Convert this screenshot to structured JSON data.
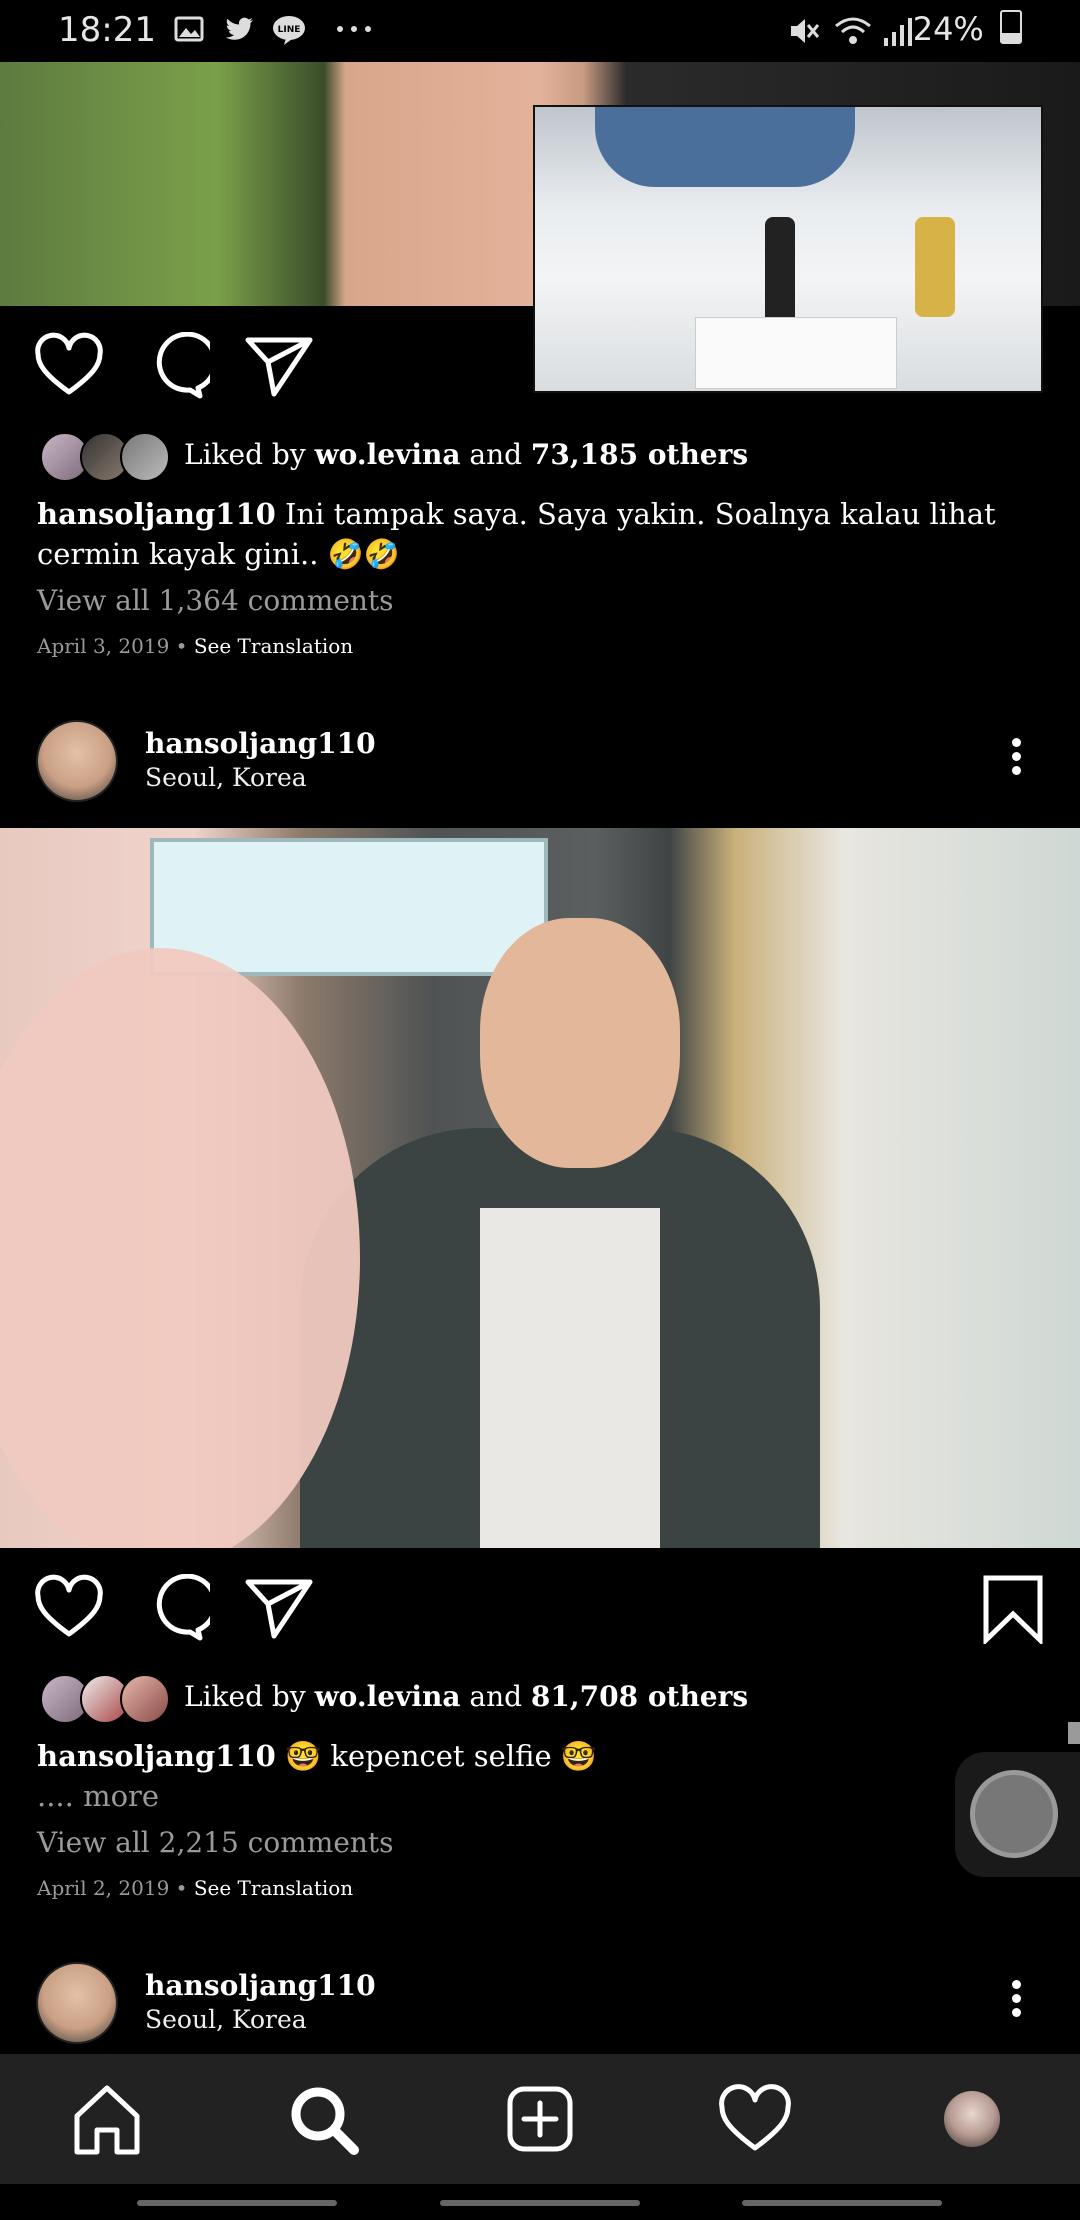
{
  "status_bar": {
    "time": "18:21",
    "icons": [
      "image-icon",
      "twitter-icon",
      "line-icon",
      "more-dots-icon"
    ],
    "right_icons": [
      "mute-icon",
      "wifi-icon",
      "signal-icon"
    ],
    "battery": "24%"
  },
  "post1": {
    "liked_prefix": "Liked by ",
    "liked_user": "wo.levina",
    "liked_and": " and ",
    "liked_others": "73,185 others",
    "caption_user": "hansoljang110",
    "caption_text": " Ini tampak saya. Saya yakin. Soalnya kalau lihat cermin kayak gini.. 🤣🤣",
    "view_comments": "View all 1,364 comments",
    "date": "April 3, 2019 • ",
    "see_translation": "See Translation"
  },
  "post2": {
    "username": "hansoljang110",
    "location": "Seoul, Korea",
    "liked_prefix": "Liked by ",
    "liked_user": "wo.levina",
    "liked_and": " and ",
    "liked_others": "81,708 others",
    "caption_user": "hansoljang110",
    "caption_text": " 🤓 kepencet selfie 🤓",
    "more_prefix": "....",
    "more": " more",
    "view_comments": "View all 2,215 comments",
    "date": "April 2, 2019 • ",
    "see_translation": "See Translation"
  },
  "post3": {
    "username": "hansoljang110",
    "location": "Seoul, Korea"
  },
  "nav": [
    "home-icon",
    "search-icon",
    "add-post-icon",
    "activity-heart-icon",
    "profile-avatar"
  ],
  "colors": {
    "background": "#000000",
    "nav_bg": "#222222",
    "muted_text": "#9a9a9a"
  }
}
